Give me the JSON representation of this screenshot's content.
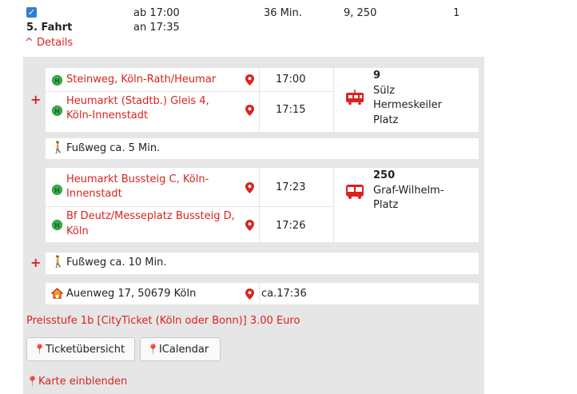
{
  "header": {
    "checkbox_checked": true,
    "ride_label": "5. Fahrt",
    "departure": "ab 17:00",
    "arrival": "an 17:35",
    "duration": "36 Min.",
    "lines": "9, 250",
    "changes": "1",
    "details_label": "^ Details"
  },
  "segments": {
    "tram": {
      "from_stop": "Steinweg, Köln-Rath/Heumar",
      "from_time": "17:00",
      "to_stop_line1": "Heumarkt (Stadtb.) Gleis 4,",
      "to_stop_line2": "Köln-Innenstadt",
      "to_time": "17:15",
      "line_number": "9",
      "direction_line1": "Sülz",
      "direction_line2": "Hermeskeiler",
      "direction_line3": "Platz"
    },
    "walk1": {
      "label": "Fußweg ca. 5 Min."
    },
    "bus": {
      "from_stop_line1": "Heumarkt Bussteig C, Köln-",
      "from_stop_line2": "Innenstadt",
      "from_time": "17:23",
      "to_stop_line1": "Bf Deutz/Messeplatz Bussteig D,",
      "to_stop_line2": "Köln",
      "to_time": "17:26",
      "line_number": "250",
      "direction_line1": "Graf-Wilhelm-",
      "direction_line2": "Platz"
    },
    "walk2": {
      "label": "Fußweg ca. 10 Min."
    },
    "destination": {
      "address": "Auenweg 17, 50679 Köln",
      "time": "ca.17:36"
    }
  },
  "price_text": "Preisstufe 1b [CityTicket (Köln oder Bonn)] 3.00 Euro",
  "buttons": {
    "ticket": "Ticketübersicht",
    "calendar": "ICalendar"
  },
  "map_link": "Karte einblenden",
  "icons": {
    "stop": "H",
    "plus": "+"
  },
  "colors": {
    "accent": "#d9231f",
    "panel": "#e6e6e6",
    "stop_icon": "#36b34a",
    "checkbox": "#2f7fd8"
  }
}
